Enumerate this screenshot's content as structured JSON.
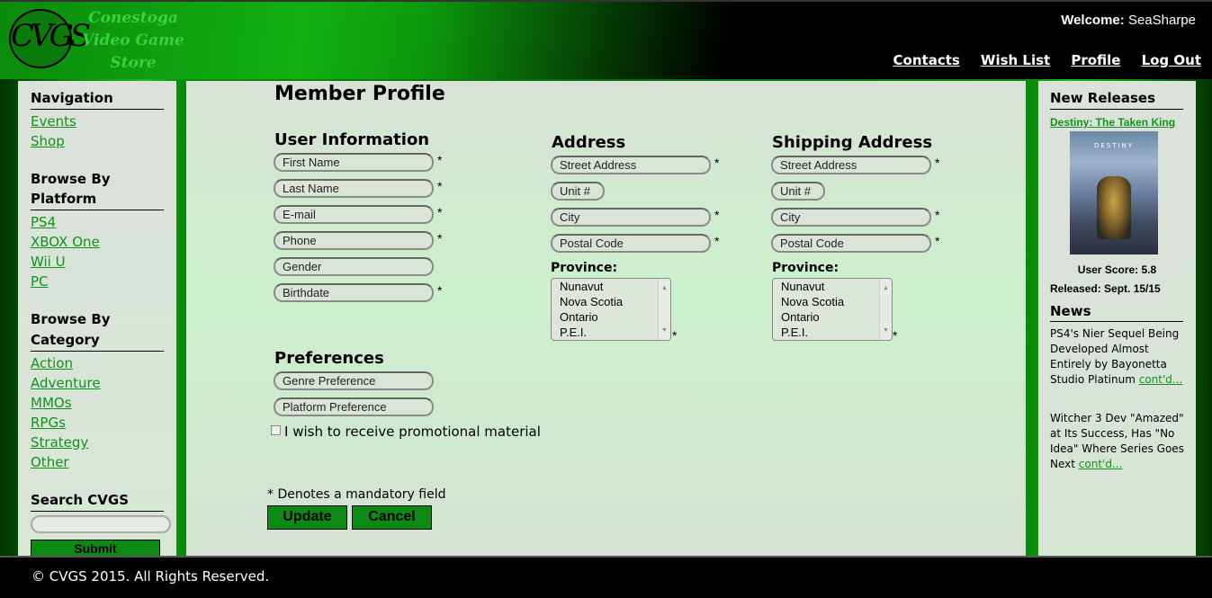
{
  "header": {
    "logo_letters": "CVGS",
    "store_name_lines": [
      "Conestoga",
      "Video Game",
      "Store"
    ],
    "welcome_label": "Welcome:",
    "username": "SeaSharpe",
    "nav": [
      "Contacts",
      "Wish List",
      "Profile",
      "Log Out"
    ]
  },
  "sidebar": {
    "navigation": {
      "title": "Navigation",
      "items": [
        "Events",
        "Shop"
      ]
    },
    "platform": {
      "title": "Browse By Platform",
      "items": [
        "PS4",
        "XBOX One",
        "Wii U",
        "PC"
      ]
    },
    "category": {
      "title_line1": "Browse By",
      "title_line2": "Category",
      "items": [
        "Action",
        "Adventure",
        "MMOs",
        "RPGs",
        "Strategy",
        "Other"
      ]
    },
    "search": {
      "title": "Search CVGS",
      "value": "",
      "submit": "Submit"
    }
  },
  "main": {
    "page_title": "Member Profile",
    "user_info": {
      "title": "User Information",
      "fields": [
        "First Name",
        "Last Name",
        "E-mail",
        "Phone",
        "Gender",
        "Birthdate"
      ]
    },
    "address": {
      "title": "Address",
      "fields": [
        "Street Address",
        "Unit #",
        "City",
        "Postal Code"
      ],
      "province_label": "Province:",
      "province_options": [
        "Nunavut",
        "Nova Scotia",
        "Ontario",
        "P.E.I."
      ]
    },
    "shipping": {
      "title": "Shipping Address",
      "fields": [
        "Street Address",
        "Unit #",
        "City",
        "Postal Code"
      ],
      "province_label": "Province:",
      "province_options": [
        "Nunavut",
        "Nova Scotia",
        "Ontario",
        "P.E.I."
      ]
    },
    "preferences": {
      "title": "Preferences",
      "fields": [
        "Genre Preference",
        "Platform Preference"
      ],
      "promo_label": "I wish to receive promotional material"
    },
    "required_marker": "*",
    "mandatory_note": "* Denotes a mandatory field",
    "update_label": "Update",
    "cancel_label": "Cancel"
  },
  "right": {
    "new_releases_title": "New Releases",
    "release": {
      "title": "Destiny: The Taken King",
      "cover_brand": "DESTINY",
      "score": "User Score: 5.8",
      "released": "Released: Sept. 15/15"
    },
    "news_title": "News",
    "news": [
      {
        "text": "PS4's Nier Sequel Being Developed Almost Entirely by Bayonetta Studio Platinum ",
        "link": "cont'd..."
      },
      {
        "text": "Witcher 3 Dev \"Amazed\" at Its Success, Has \"No Idea\" Where Series Goes Next ",
        "link": "cont'd..."
      }
    ]
  },
  "footer": {
    "text": "© CVGS 2015. All Rights Reserved."
  },
  "colors": {
    "accent": "#11931b",
    "button": "#0d8a14",
    "header_bg": "#000000",
    "page_green": "#0a8a0a"
  }
}
